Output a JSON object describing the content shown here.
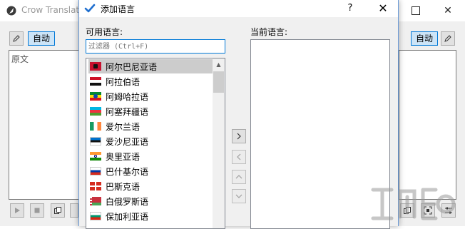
{
  "main_window": {
    "title": "Crow Translat",
    "auto_left": "自动",
    "auto_right": "自动",
    "source_placeholder": "原文"
  },
  "dialog": {
    "title": "添加语言",
    "help": "?",
    "close": "✕",
    "available_label": "可用语言:",
    "current_label": "当前语言:",
    "filter_placeholder": "过滤器 (Ctrl+F)",
    "languages": [
      {
        "name": "阿尔巴尼亚语",
        "selected": true
      },
      {
        "name": "阿拉伯语"
      },
      {
        "name": "阿姆哈拉语"
      },
      {
        "name": "阿塞拜疆语"
      },
      {
        "name": "爱尔兰语"
      },
      {
        "name": "爱沙尼亚语"
      },
      {
        "name": "奥里亚语"
      },
      {
        "name": "巴什基尔语"
      },
      {
        "name": "巴斯克语"
      },
      {
        "name": "白俄罗斯语"
      },
      {
        "name": "保加利亚语"
      }
    ]
  },
  "icons": {
    "app": "crow-logo-icon",
    "check": "checkmark-icon",
    "move_right": "chevron-right-icon",
    "move_left": "chevron-left-icon",
    "move_up": "chevron-up-icon",
    "move_down": "chevron-down-icon"
  },
  "colors": {
    "accent": "#0078d7",
    "selection": "#cccccc"
  }
}
